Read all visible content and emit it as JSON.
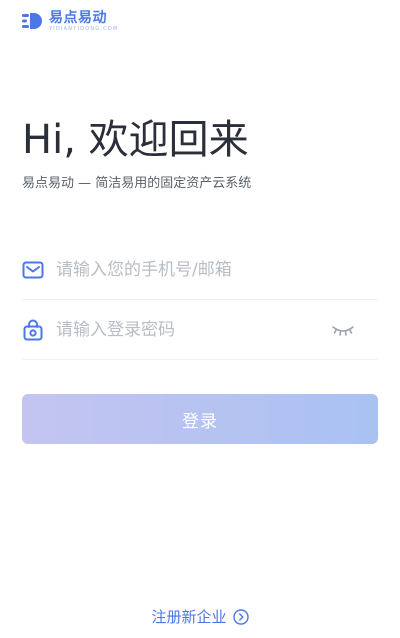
{
  "brand": {
    "name": "易点易动",
    "subname": "YIDIANYIDONG.COM",
    "accent": "#4a78e6"
  },
  "hero": {
    "title": "Hi, 欢迎回来",
    "subtitle": "易点易动 — 简洁易用的固定资产云系统"
  },
  "form": {
    "account": {
      "icon": "mail-icon",
      "placeholder": "请输入您的手机号/邮箱",
      "value": ""
    },
    "password": {
      "icon": "lock-icon",
      "placeholder": "请输入登录密码",
      "value": "",
      "toggle_icon": "eye-closed-icon"
    },
    "login_label": "登录"
  },
  "footer": {
    "register_label": "注册新企业",
    "register_icon": "chevron-right-circle-icon"
  }
}
